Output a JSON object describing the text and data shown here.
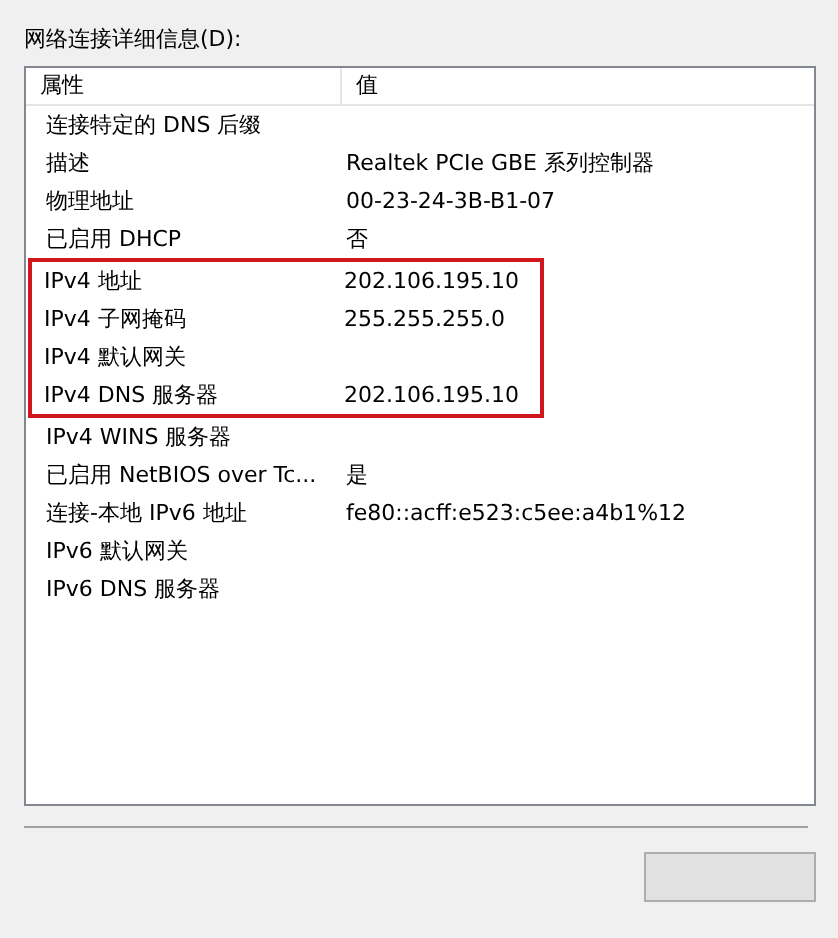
{
  "label": "网络连接详细信息(D):",
  "table": {
    "columns": [
      "属性",
      "值"
    ],
    "rows": [
      {
        "property": "连接特定的 DNS 后缀",
        "value": "",
        "highlighted": false
      },
      {
        "property": "描述",
        "value": "Realtek PCIe GBE 系列控制器",
        "highlighted": false
      },
      {
        "property": "物理地址",
        "value": "00-23-24-3B-B1-07",
        "highlighted": false
      },
      {
        "property": "已启用 DHCP",
        "value": "否",
        "highlighted": false
      },
      {
        "property": "IPv4 地址",
        "value": "202.106.195.10",
        "highlighted": true
      },
      {
        "property": "IPv4 子网掩码",
        "value": "255.255.255.0",
        "highlighted": true
      },
      {
        "property": "IPv4 默认网关",
        "value": "",
        "highlighted": true
      },
      {
        "property": "IPv4 DNS 服务器",
        "value": "202.106.195.10",
        "highlighted": true
      },
      {
        "property": "IPv4 WINS 服务器",
        "value": "",
        "highlighted": false
      },
      {
        "property": "已启用 NetBIOS over Tc...",
        "value": "是",
        "highlighted": false
      },
      {
        "property": "连接-本地 IPv6 地址",
        "value": "fe80::acff:e523:c5ee:a4b1%12",
        "highlighted": false
      },
      {
        "property": "IPv6 默认网关",
        "value": "",
        "highlighted": false
      },
      {
        "property": "IPv6 DNS 服务器",
        "value": "",
        "highlighted": false
      }
    ]
  },
  "buttons": [
    {
      "kind": "plain"
    }
  ]
}
